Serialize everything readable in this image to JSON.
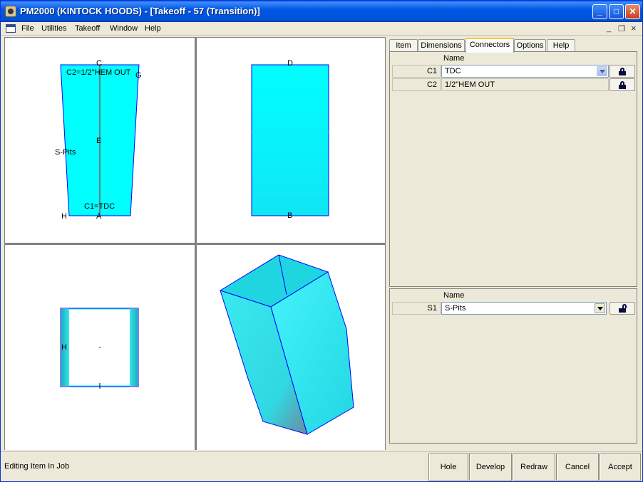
{
  "window": {
    "title": "PM2000 (KINTOCK HOODS) - [Takeoff - 57 (Transition)]",
    "controls": {
      "minimize": "_",
      "maximize": "□",
      "close": "✕"
    }
  },
  "menu": {
    "items": [
      "File",
      "Utilities",
      "Takeoff",
      "Window",
      "Help"
    ],
    "mdi": {
      "minimize": "_",
      "restore": "❐",
      "close": "×"
    }
  },
  "views": {
    "front": {
      "label_c": "C",
      "label_c2": "C2=1/2\"HEM OUT",
      "label_g": "G",
      "label_e": "E",
      "label_spits": "S-Pits",
      "label_c1": "C1=TDC",
      "label_h": "H",
      "label_a": "A"
    },
    "side": {
      "label_d": "D",
      "label_b": "B"
    },
    "top": {
      "label_h": "H"
    }
  },
  "colors": {
    "fill": "#00ffff",
    "outline": "#0000ff",
    "centerline": "#cc0000"
  },
  "tabs": [
    {
      "label": "Item",
      "active": false
    },
    {
      "label": "Dimensions",
      "active": false
    },
    {
      "label": "Connectors",
      "active": true
    },
    {
      "label": "Options",
      "active": false
    },
    {
      "label": "Help",
      "active": false
    }
  ],
  "connectors": {
    "header": "Name",
    "rows": [
      {
        "id": "C1",
        "name": "TDC",
        "locked": true,
        "is_select": true
      },
      {
        "id": "C2",
        "name": "1/2\"HEM OUT",
        "locked": true,
        "is_select": false
      }
    ]
  },
  "seams": {
    "header": "Name",
    "rows": [
      {
        "id": "S1",
        "name": "S-Pits",
        "locked": false,
        "is_select": true
      }
    ]
  },
  "status": {
    "text": "Editing Item In Job"
  },
  "buttons": {
    "hole": "Hole",
    "develop": "Develop",
    "redraw": "Redraw",
    "cancel": "Cancel",
    "accept": "Accept"
  }
}
